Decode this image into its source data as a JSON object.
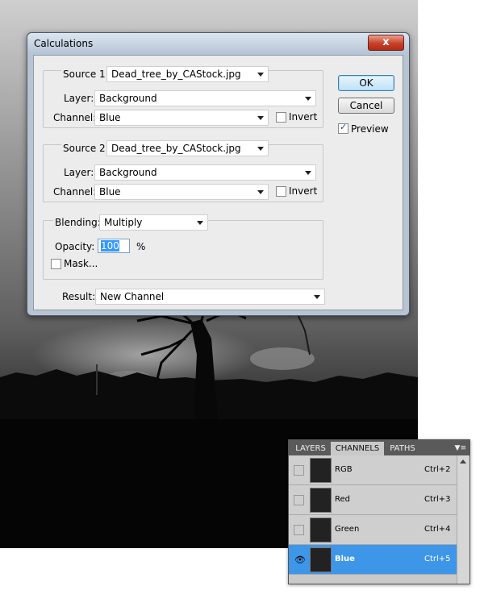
{
  "dialog": {
    "title": "Calculations",
    "close_symbol": "x",
    "source1": {
      "label": "Source 1:",
      "file": "Dead_tree_by_CAStock.jpg",
      "layer_label": "Layer:",
      "layer": "Background",
      "channel_label": "Channel:",
      "channel": "Blue",
      "invert_label": "Invert",
      "invert_checked": false
    },
    "source2": {
      "label": "Source 2:",
      "file": "Dead_tree_by_CAStock.jpg",
      "layer_label": "Layer:",
      "layer": "Background",
      "channel_label": "Channel:",
      "channel": "Blue",
      "invert_label": "Invert",
      "invert_checked": false
    },
    "blending": {
      "label": "Blending:",
      "mode": "Multiply",
      "opacity_label": "Opacity:",
      "opacity": "100",
      "unit": "%",
      "mask_label": "Mask..."
    },
    "result": {
      "label": "Result:",
      "value": "New Channel"
    },
    "buttons": {
      "ok": "OK",
      "cancel": "Cancel"
    },
    "preview": {
      "label": "Preview",
      "checked": true
    }
  },
  "panel": {
    "tabs": [
      "LAYERS",
      "CHANNELS",
      "PATHS"
    ],
    "active_tab": "CHANNELS",
    "channels": [
      {
        "name": "RGB",
        "shortcut": "Ctrl+2",
        "visible": false,
        "selected": false
      },
      {
        "name": "Red",
        "shortcut": "Ctrl+3",
        "visible": false,
        "selected": false
      },
      {
        "name": "Green",
        "shortcut": "Ctrl+4",
        "visible": false,
        "selected": false
      },
      {
        "name": "Blue",
        "shortcut": "Ctrl+5",
        "visible": true,
        "selected": true
      }
    ]
  },
  "colors": {
    "selection": "#3d96e8",
    "ok_button": "#bfe1f7",
    "close_button": "#c8412a"
  },
  "icons": {
    "close": "close-icon",
    "eye": "eye-icon",
    "panel_menu": "panel-menu-icon",
    "dropdown": "chevron-down-icon",
    "thumbnail": "dead-tree-thumbnail"
  }
}
